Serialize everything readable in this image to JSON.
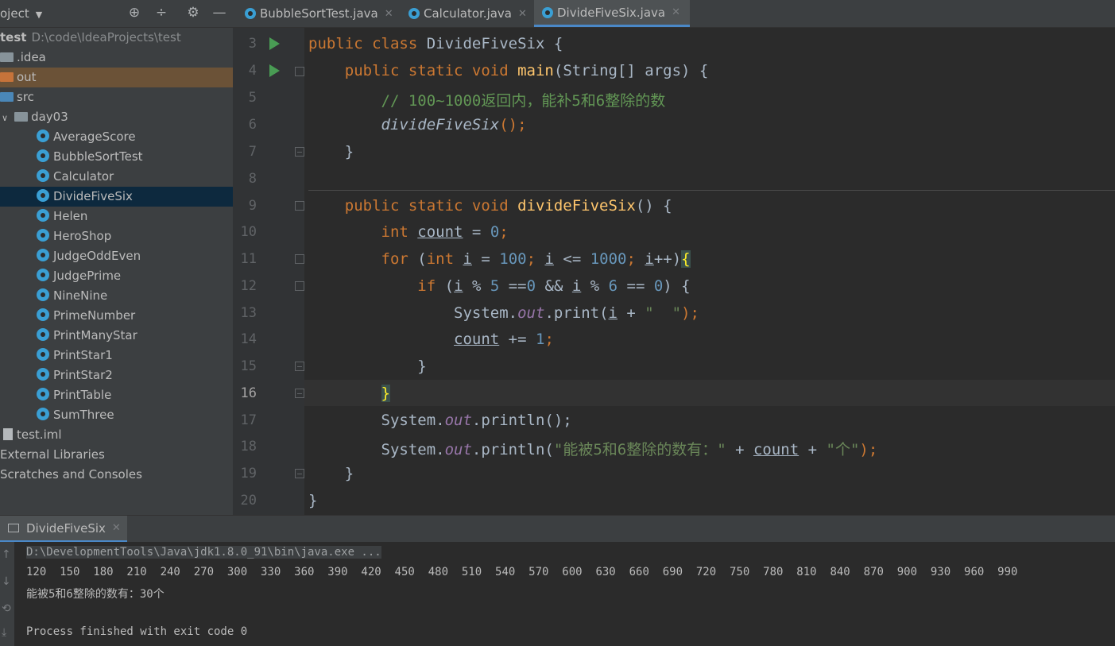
{
  "toolbar": {
    "project_label": "oject",
    "icons": [
      "globe-icon",
      "collapse-icon",
      "gear-icon",
      "minimize-icon"
    ]
  },
  "tabs": [
    {
      "label": "BubbleSortTest.java",
      "active": false
    },
    {
      "label": "Calculator.java",
      "active": false
    },
    {
      "label": "DivideFiveSix.java",
      "active": true
    }
  ],
  "tree": {
    "root_name": "test",
    "root_path": "D:\\code\\IdeaProjects\\test",
    "idea": ".idea",
    "out": "out",
    "src": "src",
    "package": "day03",
    "classes": [
      "AverageScore",
      "BubbleSortTest",
      "Calculator",
      "DivideFiveSix",
      "Helen",
      "HeroShop",
      "JudgeOddEven",
      "JudgePrime",
      "NineNine",
      "PrimeNumber",
      "PrintManyStar",
      "PrintStar1",
      "PrintStar2",
      "PrintTable",
      "SumThree"
    ],
    "iml": "test.iml",
    "external": "External Libraries",
    "scratches": "Scratches and Consoles"
  },
  "editor": {
    "line_numbers": [
      "3",
      "4",
      "5",
      "6",
      "7",
      "8",
      "9",
      "10",
      "11",
      "12",
      "13",
      "14",
      "15",
      "16",
      "17",
      "18",
      "19",
      "20"
    ],
    "current_line": "16",
    "code": {
      "l3_a": "public class ",
      "l3_b": "DivideFiveSix {",
      "l4_a": "    public static void ",
      "l4_b": "main",
      "l4_c": "(String[] args) {",
      "l5": "        // 100~1000返回内，能补5和6整除的数",
      "l6_a": "        ",
      "l6_b": "divideFiveSix",
      "l6_c": "();",
      "l7": "    }",
      "l9_a": "    public static void ",
      "l9_b": "divideFiveSix",
      "l9_c": "() {",
      "l10_a": "        ",
      "l10_kw": "int ",
      "l10_var": "count",
      "l10_eq": " = ",
      "l10_num": "0",
      "l10_end": ";",
      "l11_a": "        ",
      "l11_for": "for ",
      "l11_p": "(",
      "l11_int": "int ",
      "l11_i1": "i",
      "l11_eq": " = ",
      "l11_n1": "100",
      "l11_s1": "; ",
      "l11_i2": "i",
      "l11_le": " <= ",
      "l11_n2": "1000",
      "l11_s2": "; ",
      "l11_i3": "i",
      "l11_pp": "++)",
      "l11_br": "{",
      "l12_a": "            ",
      "l12_if": "if ",
      "l12_p": "(",
      "l12_i1": "i",
      "l12_m1": " % ",
      "l12_n1": "5",
      "l12_e1": " ==",
      "l12_n2": "0",
      "l12_and": " && ",
      "l12_i2": "i",
      "l12_m2": " % ",
      "l12_n3": "6",
      "l12_e2": " == ",
      "l12_n4": "0",
      "l12_end": ") {",
      "l13_a": "                System.",
      "l13_out": "out",
      "l13_b": ".print(",
      "l13_i": "i",
      "l13_plus": " + ",
      "l13_str": "\"  \"",
      "l13_end": ");",
      "l14_a": "                ",
      "l14_var": "count",
      "l14_op": " += ",
      "l14_num": "1",
      "l14_end": ";",
      "l15": "            }",
      "l16_a": "        ",
      "l16_br": "}",
      "l17_a": "        System.",
      "l17_out": "out",
      "l17_b": ".println();",
      "l18_a": "        System.",
      "l18_out": "out",
      "l18_b": ".println(",
      "l18_str": "\"能被5和6整除的数有：\"",
      "l18_plus": " + ",
      "l18_var": "count",
      "l18_plus2": " + ",
      "l18_str2": "\"个\"",
      "l18_end": ");",
      "l19": "    }",
      "l20": "}"
    }
  },
  "run": {
    "tab_label": "DivideFiveSix",
    "command": "D:\\DevelopmentTools\\Java\\jdk1.8.0_91\\bin\\java.exe ...",
    "output": "120  150  180  210  240  270  300  330  360  390  420  450  480  510  540  570  600  630  660  690  720  750  780  810  840  870  900  930  960  990",
    "summary": "能被5和6整除的数有：30个",
    "exit": "Process finished with exit code 0"
  }
}
